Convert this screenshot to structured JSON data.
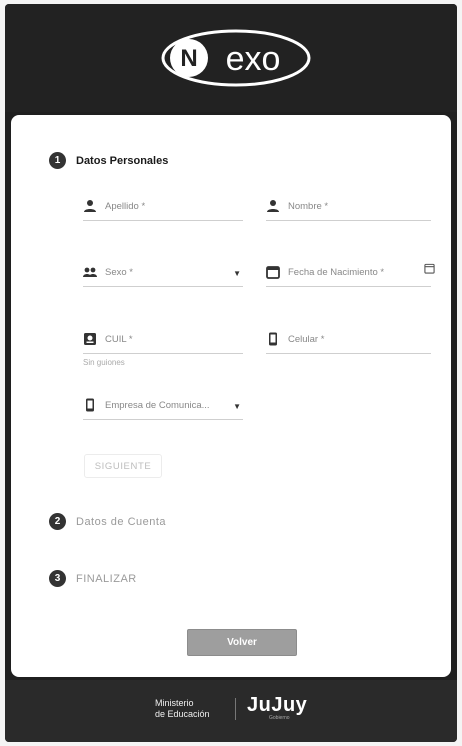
{
  "header": {
    "logo_text": "exo",
    "logo_letter": "N"
  },
  "steps": [
    {
      "number": "1",
      "title": "Datos Personales",
      "active": true
    },
    {
      "number": "2",
      "title": "Datos de Cuenta",
      "active": false
    },
    {
      "number": "3",
      "title": "FINALIZAR",
      "active": false
    }
  ],
  "form": {
    "apellido_label": "Apellido *",
    "nombre_label": "Nombre *",
    "sexo_label": "Sexo *",
    "fecha_label": "Fecha de Nacimiento *",
    "cuil_label": "CUIL *",
    "cuil_helper": "Sin guiones",
    "celular_label": "Celular *",
    "empresa_label": "Empresa de Comunica..."
  },
  "buttons": {
    "siguiente": "SIGUIENTE",
    "volver": "Volver"
  },
  "footer": {
    "ministry_line1": "Ministerio",
    "ministry_line2": "de Educación",
    "province": "JuJuy",
    "province_sub": "Gobierno"
  },
  "icons": {
    "apellido": "person-icon",
    "nombre": "person-icon",
    "sexo": "people-icon",
    "fecha": "calendar-icon",
    "cuil": "id-card-icon",
    "celular": "phone-icon",
    "empresa": "phone-icon"
  }
}
